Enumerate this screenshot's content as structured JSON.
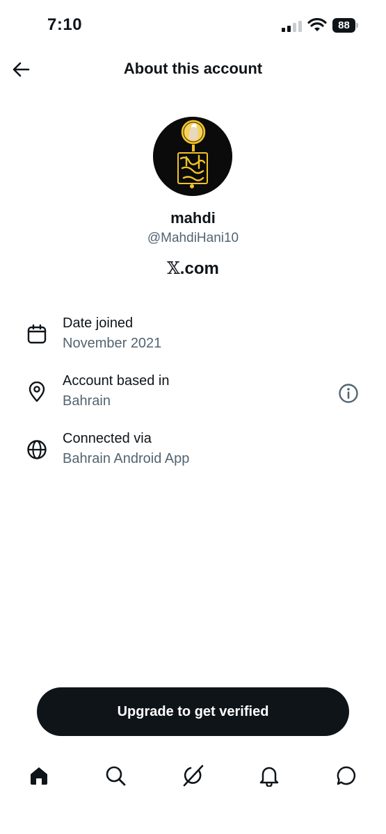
{
  "status_bar": {
    "time": "7:10",
    "battery_level": "88",
    "signal_bars_active": 2,
    "signal_bars_total": 4
  },
  "header": {
    "title": "About this account",
    "back_icon": "arrow-left-icon"
  },
  "profile": {
    "display_name": "mahdi",
    "handle": "@MahdiHani10",
    "domain_glyph": "𝕏",
    "domain_suffix": ".com",
    "avatar_colors": {
      "background": "#0b0b0b",
      "accent": "#f2c326"
    }
  },
  "info": [
    {
      "icon": "calendar-icon",
      "title": "Date joined",
      "value": "November 2021"
    },
    {
      "icon": "location-pin-icon",
      "title": "Account based in",
      "value": "Bahrain",
      "extra_icon": "info-icon"
    },
    {
      "icon": "globe-icon",
      "title": "Connected via",
      "value": "Bahrain Android App"
    }
  ],
  "cta": {
    "label": "Upgrade to get verified"
  },
  "nav": {
    "items": [
      {
        "icon": "home-icon",
        "active": true
      },
      {
        "icon": "search-icon",
        "active": false
      },
      {
        "icon": "grok-icon",
        "active": false
      },
      {
        "icon": "bell-icon",
        "active": false
      },
      {
        "icon": "messages-icon",
        "active": false
      }
    ]
  },
  "colors": {
    "text_primary": "#0f1419",
    "text_secondary": "#536471",
    "button_bg": "#0f1419",
    "background": "#ffffff"
  }
}
